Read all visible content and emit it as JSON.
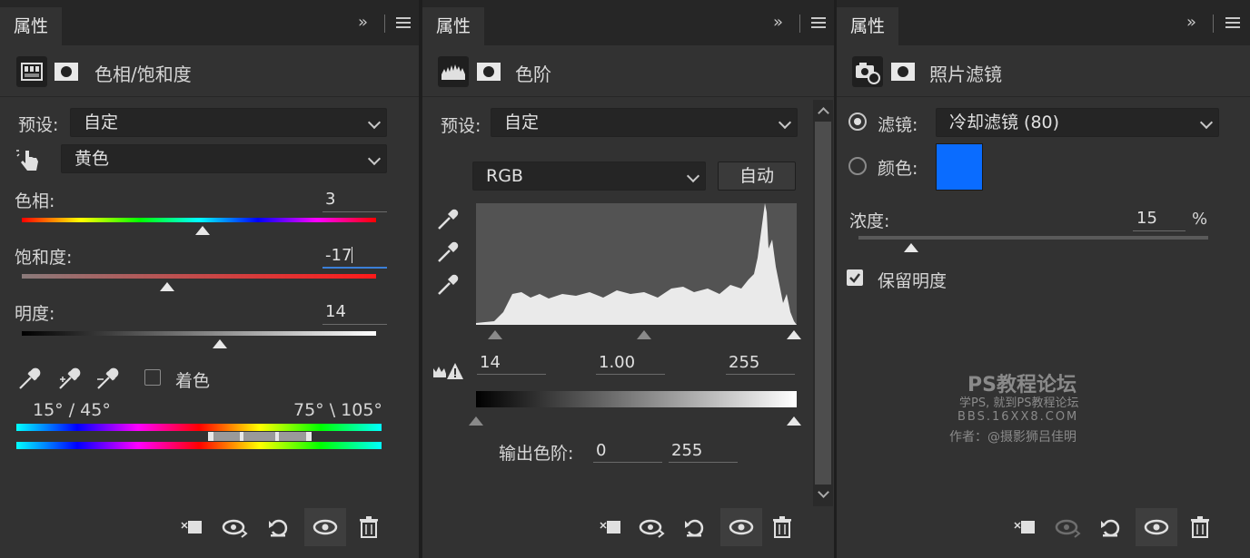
{
  "panel1": {
    "tab": "属性",
    "title": "色相/饱和度",
    "preset_label": "预设:",
    "preset_value": "自定",
    "channel_value": "黄色",
    "hue_label": "色相:",
    "hue_value": "3",
    "sat_label": "饱和度:",
    "sat_value": "-17",
    "light_label": "明度:",
    "light_value": "14",
    "colorize_label": "着色",
    "range_left": "15° / 45°",
    "range_right": "75° \\ 105°",
    "hue_slider_fraction": 0.51,
    "sat_slider_fraction": 0.41,
    "light_slider_fraction": 0.56
  },
  "panel2": {
    "tab": "属性",
    "title": "色阶",
    "preset_label": "预设:",
    "preset_value": "自定",
    "channel_value": "RGB",
    "auto_label": "自动",
    "input_black": "14",
    "input_gamma": "1.00",
    "input_white": "255",
    "output_label": "输出色阶:",
    "output_black": "0",
    "output_white": "255"
  },
  "panel3": {
    "tab": "属性",
    "title": "照片滤镜",
    "filter_label": "滤镜:",
    "filter_value": "冷却滤镜 (80)",
    "color_label": "颜色:",
    "swatch_color": "#0a6cff",
    "density_label": "浓度:",
    "density_value": "15",
    "density_unit": "%",
    "density_fraction": 0.15,
    "preserve_label": "保留明度"
  },
  "watermark": {
    "line1": "PS教程论坛",
    "line2": "学PS, 就到PS教程论坛",
    "line3": "BBS.16XX8.COM",
    "line4": "作者：@摄影狮吕佳明"
  },
  "icons": {
    "collapse": "double-chevron-right-icon",
    "menu": "menu-icon",
    "clip": "clip-to-layer-icon",
    "view_previous": "view-previous-state-icon",
    "reset": "reset-icon",
    "visibility": "eye-icon",
    "delete": "trash-icon"
  }
}
